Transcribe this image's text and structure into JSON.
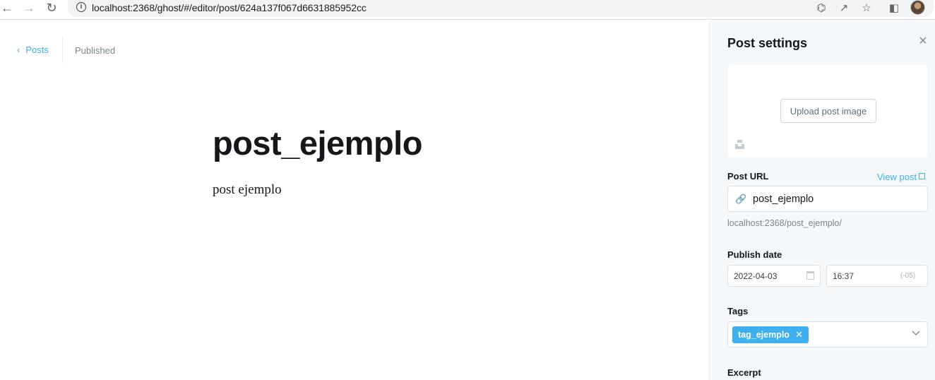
{
  "browser": {
    "url": "localhost:2368/ghost/#/editor/post/624a137f067d6631885952cc",
    "back_icon": "arrow-left-icon",
    "forward_icon": "arrow-right-icon",
    "reload_icon": "reload-icon",
    "site_info_icon": "info-icon",
    "action_icons": [
      "translate-icon",
      "share-icon",
      "star-icon",
      "sidepanel-icon",
      "avatar"
    ]
  },
  "editor": {
    "back_label": "Posts",
    "status": "Published",
    "title": "post_ejemplo",
    "body": "post ejemplo"
  },
  "settings": {
    "title": "Post settings",
    "upload_label": "Upload post image",
    "url_label": "Post URL",
    "view_post_label": "View post",
    "slug": "post_ejemplo",
    "url_hint": "localhost:2368/post_ejemplo/",
    "publish_label": "Publish date",
    "date": "2022-04-03",
    "time": "16:37",
    "timezone": "(-05)",
    "tags_label": "Tags",
    "tags": [
      "tag_ejemplo"
    ],
    "excerpt_label": "Excerpt"
  },
  "colors": {
    "accent": "#3eb0ef",
    "panel_bg": "#f4f8fb",
    "text": "#15171a",
    "muted": "#7d878a"
  }
}
